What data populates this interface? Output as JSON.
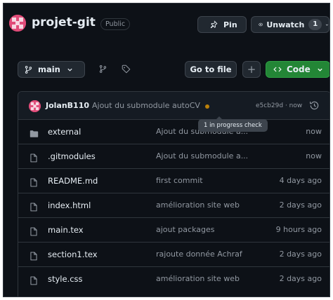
{
  "repo": {
    "name": "projet-git",
    "visibility": "Public"
  },
  "header_actions": {
    "pin_label": "Pin",
    "watch_label": "Unwatch",
    "watch_count": "1"
  },
  "toolbar": {
    "branch": "main",
    "go_to_file": "Go to file",
    "add": "+",
    "code": "Code"
  },
  "commit": {
    "author": "JolanB110",
    "message": "Ajout du submodule autoCV",
    "meta": "e5cb29d · now",
    "tooltip": "1 in progress check",
    "status_color": "#bb8009"
  },
  "files": [
    {
      "name": "external",
      "type": "folder",
      "message": "Ajout du submodule a...",
      "time": "now"
    },
    {
      "name": ".gitmodules",
      "type": "file",
      "message": "Ajout du submodule a...",
      "time": "now"
    },
    {
      "name": "README.md",
      "type": "file",
      "message": "first commit",
      "time": "4 days ago"
    },
    {
      "name": "index.html",
      "type": "file",
      "message": "amélioration site web",
      "time": "2 days ago"
    },
    {
      "name": "main.tex",
      "type": "file",
      "message": "ajout packages",
      "time": "9 hours ago"
    },
    {
      "name": "section1.tex",
      "type": "file",
      "message": "rajoute donnée Achraf",
      "time": "2 days ago"
    },
    {
      "name": "style.css",
      "type": "file",
      "message": "amélioration site web",
      "time": "2 days ago"
    }
  ],
  "colors": {
    "background": "#0d1117",
    "border": "#30363d",
    "code_button": "#238636",
    "text": "#e6edf3",
    "muted": "#9198a1"
  }
}
